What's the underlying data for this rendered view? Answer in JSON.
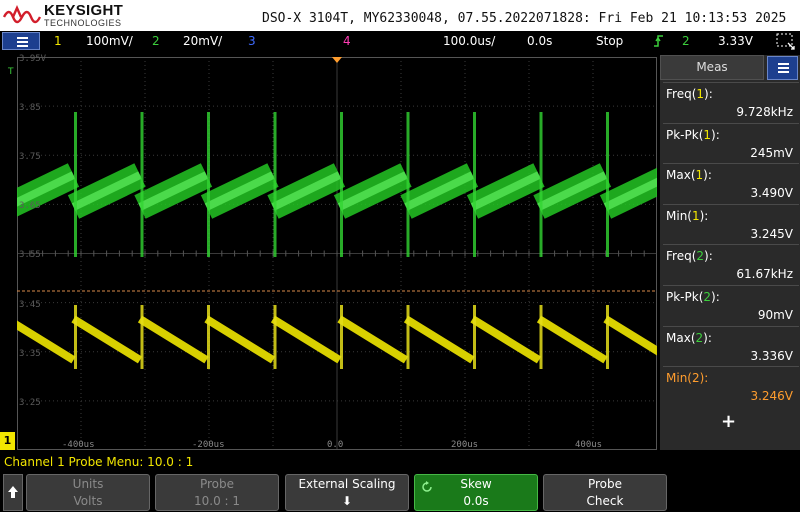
{
  "header": {
    "brand": "KEYSIGHT",
    "brand_sub": "TECHNOLOGIES",
    "instrument_info": "DSO-X 3104T, MY62330048, 07.55.2022071828: Fri Feb 21 10:13:53 2025"
  },
  "status": {
    "ch1_num": "1",
    "ch1_scale": "100mV/",
    "ch2_num": "2",
    "ch2_scale": "20mV/",
    "ch3_num": "3",
    "ch4_num": "4",
    "timebase": "100.0us/",
    "delay": "0.0s",
    "run_state": "Stop",
    "trigger_source": "2",
    "trigger_level": "3.33V"
  },
  "graticule": {
    "y_labels": [
      "3.95V",
      "3.85",
      "3.75",
      "3.65",
      "3.55",
      "3.45",
      "3.35",
      "3.25"
    ],
    "x_labels": [
      "-400us",
      "-200us",
      "0.0",
      "200us",
      "400us"
    ],
    "trigger_marker": "T",
    "channel_marker": "1"
  },
  "measurements": {
    "tab_label": "Meas",
    "items": [
      {
        "name": "Freq",
        "ch": "1",
        "value": "9.728kHz"
      },
      {
        "name": "Pk-Pk",
        "ch": "1",
        "value": "245mV"
      },
      {
        "name": "Max",
        "ch": "1",
        "value": "3.490V"
      },
      {
        "name": "Min",
        "ch": "1",
        "value": "3.245V"
      },
      {
        "name": "Freq",
        "ch": "2",
        "value": "61.67kHz"
      },
      {
        "name": "Pk-Pk",
        "ch": "2",
        "value": "90mV"
      },
      {
        "name": "Max",
        "ch": "2",
        "value": "3.336V"
      },
      {
        "name": "Min",
        "ch": "2",
        "value": "3.246V"
      }
    ],
    "add_label": "+"
  },
  "probe_menu_text": "Channel 1 Probe Menu: 10.0 : 1",
  "softkeys": [
    {
      "line1": "Units",
      "line2": "Volts"
    },
    {
      "line1": "Probe",
      "line2": "10.0 : 1"
    },
    {
      "line1": "External Scaling",
      "line2": "⬇"
    },
    {
      "line1": "Skew",
      "line2": "0.0s"
    },
    {
      "line1": "Probe",
      "line2": "Check"
    }
  ],
  "colors": {
    "ch1": "#f2e600",
    "ch2": "#3ccf3c",
    "ch3": "#3f6bff",
    "ch4": "#ff3cb4",
    "highlight": "#ff9d2e"
  }
}
